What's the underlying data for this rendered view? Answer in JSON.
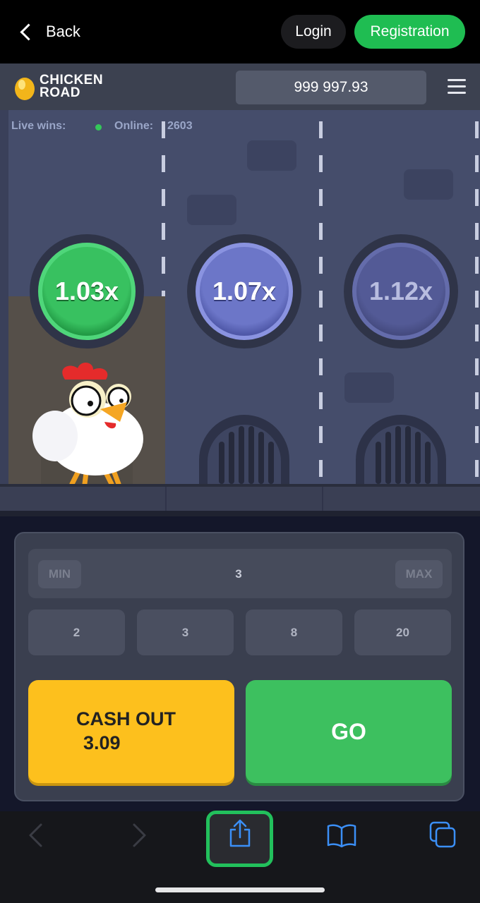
{
  "topbar": {
    "back_label": "Back",
    "login_label": "Login",
    "register_label": "Registration"
  },
  "game": {
    "logo_line1": "CHICKEN",
    "logo_line2": "ROAD",
    "balance": "999 997.93"
  },
  "status": {
    "live_wins": "Live wins:",
    "online_label": "Online:",
    "online_count": "2603"
  },
  "multipliers": [
    "1.03x",
    "1.07x",
    "1.12x"
  ],
  "bet": {
    "min_label": "MIN",
    "max_label": "MAX",
    "value": "3",
    "presets": [
      "2",
      "3",
      "8",
      "20"
    ]
  },
  "actions": {
    "cashout_label": "CASH OUT",
    "cashout_amount": "3.09",
    "go_label": "GO"
  },
  "colors": {
    "accent_green": "#3dc05f",
    "cashout_yellow": "#fdc01d",
    "registration_green": "#1fbd52"
  },
  "browser": {
    "icons": [
      "back-arrow-icon",
      "forward-arrow-icon",
      "share-icon",
      "bookmarks-icon",
      "tabs-icon"
    ]
  }
}
